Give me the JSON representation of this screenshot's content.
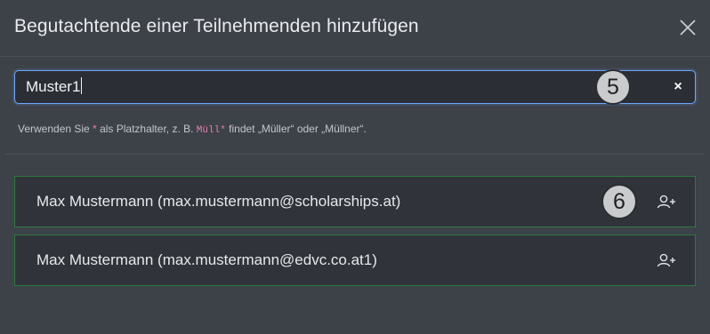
{
  "dialog": {
    "title": "Begutachtende einer Teilnehmenden hinzufügen",
    "close_icon": "close-icon"
  },
  "search": {
    "value": "Muster1",
    "clear_icon": "clear-icon",
    "clear_label": "×",
    "hint_before_star": "Verwenden Sie ",
    "hint_star": "*",
    "hint_middle": " als Platzhalter, z. B. ",
    "hint_example": "Müll*",
    "hint_after": " findet „Müller“ oder „Müllner“."
  },
  "results": [
    {
      "label": "Max Mustermann (max.mustermann@scholarships.at)",
      "icon": "add-user-icon"
    },
    {
      "label": "Max Mustermann (max.mustermann@edvc.co.at1)",
      "icon": "add-user-icon"
    }
  ],
  "markers": {
    "search": "5",
    "result": "6"
  },
  "colors": {
    "accent_focus": "#6ea8fe",
    "result_border": "#2f7a3d",
    "hint_highlight": "#e57fb1"
  }
}
